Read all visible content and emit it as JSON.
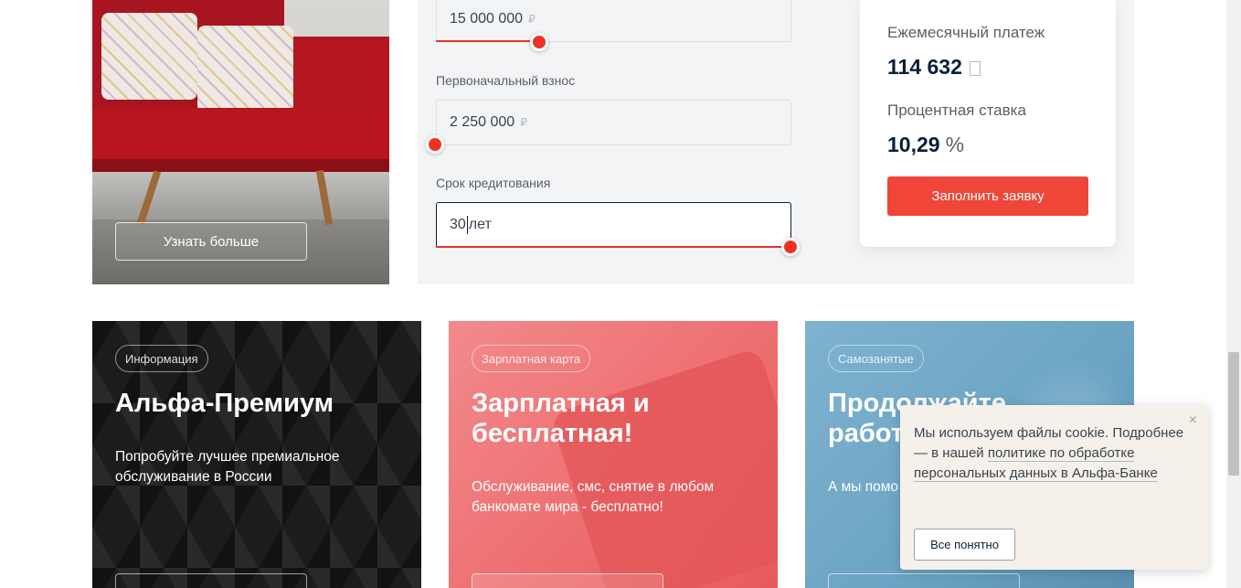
{
  "promo": {
    "learn_more_label": "Узнать больше"
  },
  "calculator": {
    "amount_value": "15 000 000",
    "amount_unit": "₽",
    "down_payment_label": "Первоначальный взнос",
    "down_payment_value": "2 250 000",
    "down_payment_unit": "₽",
    "term_label": "Срок кредитования",
    "term_value": "30",
    "term_unit": "лет"
  },
  "summary": {
    "monthly_label": "Ежемесячный платеж",
    "monthly_value": "114 632",
    "rate_label": "Процентная ставка",
    "rate_value": "10,29",
    "rate_unit": "%",
    "apply_label": "Заполнить заявку"
  },
  "cards": [
    {
      "tag": "Информация",
      "title": "Альфа-Премиум",
      "desc": "Попробуйте лучшее премиальное обслуживание в России"
    },
    {
      "tag": "Зарплатная карта",
      "title": "Зарплатная и бесплатная!",
      "desc": "Обслуживание, смс, снятие в любом банкомате мира - бесплатно!"
    },
    {
      "tag": "Самозанятые",
      "title": "Продолжайте работ",
      "desc": "А мы помо"
    }
  ],
  "cookie": {
    "text_1": "Мы используем файлы cookie. Подробнее — в нашей",
    "link": "политике по обработке персональных данных в Альфа-Банке",
    "close_icon": "×",
    "accept_label": "Все понятно"
  },
  "colors": {
    "accent": "#ef3124",
    "text_dark": "#0b1f35",
    "panel_bg": "#f3f4f5"
  }
}
